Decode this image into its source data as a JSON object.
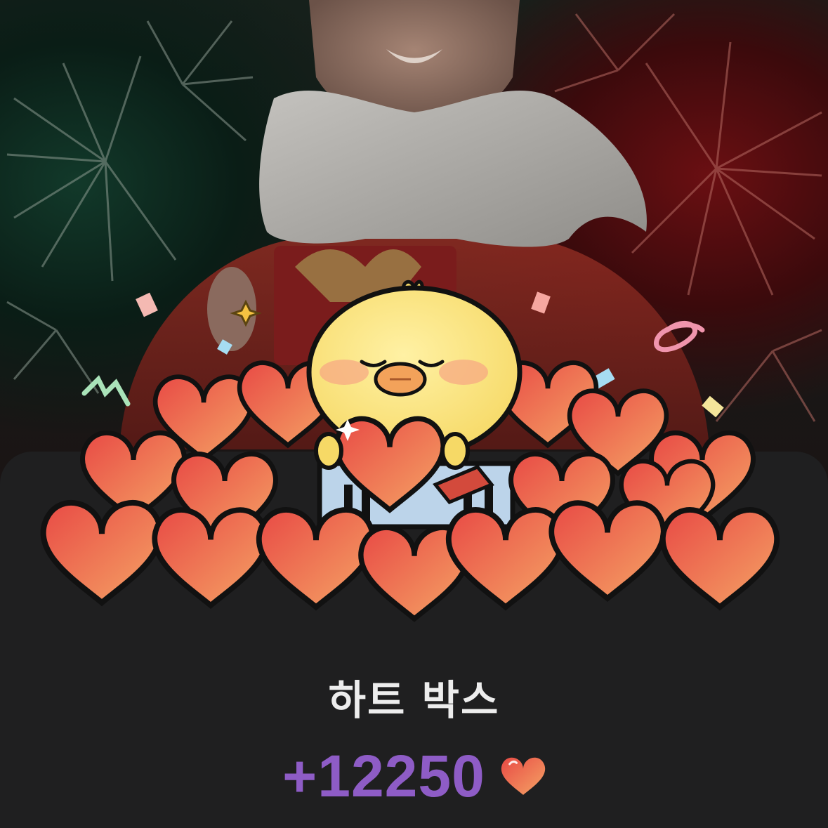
{
  "reward_popup": {
    "title": "하트 박스",
    "amount": "+12250",
    "currency_icon": "heart-icon"
  },
  "colors": {
    "sheet_background": "#1f1f20",
    "title_text": "#ededed",
    "amount_text": "#8e5cc6",
    "heart_fill_light": "#f5a465",
    "heart_fill_dark": "#e84a45"
  }
}
